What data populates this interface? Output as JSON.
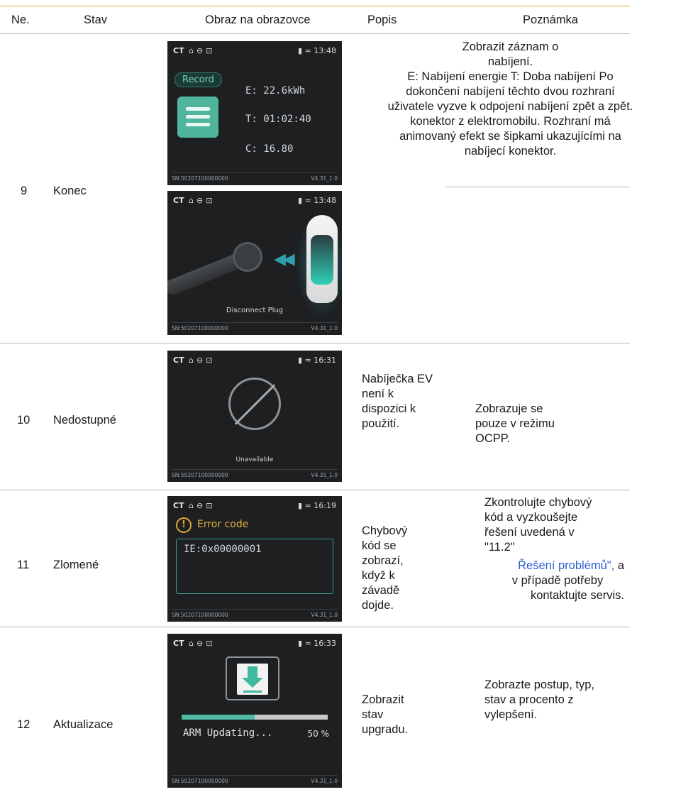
{
  "table": {
    "headers": [
      "Ne.",
      "Stav",
      "Obraz na obrazovce",
      "Popis",
      "Poznámka"
    ],
    "rows": [
      {
        "number": "9",
        "state": "Konec",
        "description_lines": [
          "Zobrazit záznam o",
          "nabíjení.",
          "E: Nabíjení energie T: Doba nabíjení Po",
          "dokončení nabíjení těchto dvou rozhraní",
          "uživatele vyzve k odpojení nabíjení zpět a zpět.",
          "konektor z elektromobilu. Rozhraní má",
          "animovaný efekt se šipkami ukazujícími na",
          "nabíjecí konektor."
        ],
        "screen_record": {
          "ct": "CT",
          "time": "13:48",
          "label": "Record",
          "energy": "E: 22.6kWh",
          "duration": "T: 01:02:40",
          "cost": "C: 16.80",
          "sn": "SN:50207100000000",
          "version": "V4.31_1.0"
        },
        "screen_disconnect": {
          "ct": "CT",
          "time": "13:48",
          "message": "Disconnect Plug",
          "sn": "SN:50207100000000",
          "version": "V4.31_1.0"
        }
      },
      {
        "number": "10",
        "state": "Nedostupné",
        "description_lines": [
          "Nabíječka EV",
          "není k",
          "dispozici k",
          "použití."
        ],
        "note_lines": [
          "Zobrazuje se",
          "pouze v režimu",
          "OCPP."
        ],
        "screen": {
          "ct": "CT",
          "time": "16:31",
          "message": "Unavailable",
          "sn": "SN:50207100000000",
          "version": "V4.31_1.0"
        }
      },
      {
        "number": "11",
        "state": "Zlomené",
        "description_lines": [
          "Chybový",
          "kód se",
          "zobrazí,",
          "když k",
          "závadě",
          "dojde."
        ],
        "note_lines": [
          "Zkontrolujte chybový",
          "kód a vyzkoušejte",
          "řešení uvedená v",
          "\"11.2\""
        ],
        "note_link": "Řešení problémů\",",
        "note_link_rest": " a",
        "note_tail_lines": [
          "v případě potřeby",
          "kontaktujte servis."
        ],
        "screen": {
          "ct": "CT",
          "time": "16:19",
          "error_title": "Error code",
          "error_code": "IE:0x00000001",
          "sn": "SN:50207100000000",
          "version": "V4.31_1.0"
        }
      },
      {
        "number": "12",
        "state": "Aktualizace",
        "description_lines": [
          "Zobrazit",
          "stav",
          "upgradu."
        ],
        "note_lines": [
          "Zobrazte postup, typ,",
          "stav a procento z",
          "vylepšení."
        ],
        "screen": {
          "ct": "CT",
          "time": "16:33",
          "status": "ARM Updating...",
          "percent_label": "50 %",
          "progress": 0.5,
          "sn": "SN:50207100000000",
          "version": "V4.31_1.0"
        }
      }
    ]
  }
}
